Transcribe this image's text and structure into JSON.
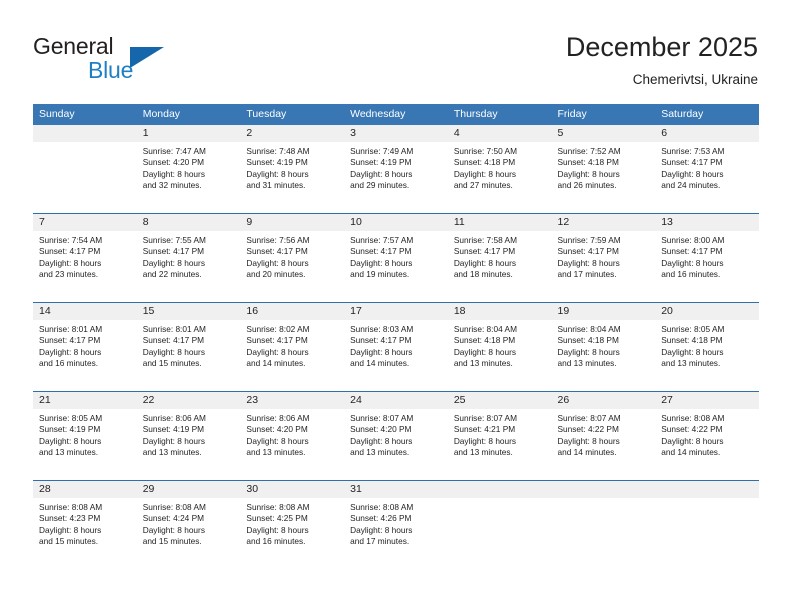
{
  "brand": {
    "name_part1": "General",
    "name_part2": "Blue",
    "logo_icon": "triangle-logo-icon"
  },
  "header": {
    "title": "December 2025",
    "subtitle": "Chemerivtsi, Ukraine"
  },
  "calendar": {
    "day_headers": [
      "Sunday",
      "Monday",
      "Tuesday",
      "Wednesday",
      "Thursday",
      "Friday",
      "Saturday"
    ],
    "colors": {
      "header_blue": "#3877b4",
      "row_divider_blue": "#2f6fad",
      "number_band_gray": "#f0f0f0",
      "brand_blue": "#1f7fc4",
      "logo_blue": "#1566ab"
    },
    "weeks": [
      {
        "days": [
          {
            "number": "",
            "sunrise": "",
            "sunset": "",
            "daylight_line1": "",
            "daylight_line2": ""
          },
          {
            "number": "1",
            "sunrise": "Sunrise: 7:47 AM",
            "sunset": "Sunset: 4:20 PM",
            "daylight_line1": "Daylight: 8 hours",
            "daylight_line2": "and 32 minutes."
          },
          {
            "number": "2",
            "sunrise": "Sunrise: 7:48 AM",
            "sunset": "Sunset: 4:19 PM",
            "daylight_line1": "Daylight: 8 hours",
            "daylight_line2": "and 31 minutes."
          },
          {
            "number": "3",
            "sunrise": "Sunrise: 7:49 AM",
            "sunset": "Sunset: 4:19 PM",
            "daylight_line1": "Daylight: 8 hours",
            "daylight_line2": "and 29 minutes."
          },
          {
            "number": "4",
            "sunrise": "Sunrise: 7:50 AM",
            "sunset": "Sunset: 4:18 PM",
            "daylight_line1": "Daylight: 8 hours",
            "daylight_line2": "and 27 minutes."
          },
          {
            "number": "5",
            "sunrise": "Sunrise: 7:52 AM",
            "sunset": "Sunset: 4:18 PM",
            "daylight_line1": "Daylight: 8 hours",
            "daylight_line2": "and 26 minutes."
          },
          {
            "number": "6",
            "sunrise": "Sunrise: 7:53 AM",
            "sunset": "Sunset: 4:17 PM",
            "daylight_line1": "Daylight: 8 hours",
            "daylight_line2": "and 24 minutes."
          }
        ]
      },
      {
        "days": [
          {
            "number": "7",
            "sunrise": "Sunrise: 7:54 AM",
            "sunset": "Sunset: 4:17 PM",
            "daylight_line1": "Daylight: 8 hours",
            "daylight_line2": "and 23 minutes."
          },
          {
            "number": "8",
            "sunrise": "Sunrise: 7:55 AM",
            "sunset": "Sunset: 4:17 PM",
            "daylight_line1": "Daylight: 8 hours",
            "daylight_line2": "and 22 minutes."
          },
          {
            "number": "9",
            "sunrise": "Sunrise: 7:56 AM",
            "sunset": "Sunset: 4:17 PM",
            "daylight_line1": "Daylight: 8 hours",
            "daylight_line2": "and 20 minutes."
          },
          {
            "number": "10",
            "sunrise": "Sunrise: 7:57 AM",
            "sunset": "Sunset: 4:17 PM",
            "daylight_line1": "Daylight: 8 hours",
            "daylight_line2": "and 19 minutes."
          },
          {
            "number": "11",
            "sunrise": "Sunrise: 7:58 AM",
            "sunset": "Sunset: 4:17 PM",
            "daylight_line1": "Daylight: 8 hours",
            "daylight_line2": "and 18 minutes."
          },
          {
            "number": "12",
            "sunrise": "Sunrise: 7:59 AM",
            "sunset": "Sunset: 4:17 PM",
            "daylight_line1": "Daylight: 8 hours",
            "daylight_line2": "and 17 minutes."
          },
          {
            "number": "13",
            "sunrise": "Sunrise: 8:00 AM",
            "sunset": "Sunset: 4:17 PM",
            "daylight_line1": "Daylight: 8 hours",
            "daylight_line2": "and 16 minutes."
          }
        ]
      },
      {
        "days": [
          {
            "number": "14",
            "sunrise": "Sunrise: 8:01 AM",
            "sunset": "Sunset: 4:17 PM",
            "daylight_line1": "Daylight: 8 hours",
            "daylight_line2": "and 16 minutes."
          },
          {
            "number": "15",
            "sunrise": "Sunrise: 8:01 AM",
            "sunset": "Sunset: 4:17 PM",
            "daylight_line1": "Daylight: 8 hours",
            "daylight_line2": "and 15 minutes."
          },
          {
            "number": "16",
            "sunrise": "Sunrise: 8:02 AM",
            "sunset": "Sunset: 4:17 PM",
            "daylight_line1": "Daylight: 8 hours",
            "daylight_line2": "and 14 minutes."
          },
          {
            "number": "17",
            "sunrise": "Sunrise: 8:03 AM",
            "sunset": "Sunset: 4:17 PM",
            "daylight_line1": "Daylight: 8 hours",
            "daylight_line2": "and 14 minutes."
          },
          {
            "number": "18",
            "sunrise": "Sunrise: 8:04 AM",
            "sunset": "Sunset: 4:18 PM",
            "daylight_line1": "Daylight: 8 hours",
            "daylight_line2": "and 13 minutes."
          },
          {
            "number": "19",
            "sunrise": "Sunrise: 8:04 AM",
            "sunset": "Sunset: 4:18 PM",
            "daylight_line1": "Daylight: 8 hours",
            "daylight_line2": "and 13 minutes."
          },
          {
            "number": "20",
            "sunrise": "Sunrise: 8:05 AM",
            "sunset": "Sunset: 4:18 PM",
            "daylight_line1": "Daylight: 8 hours",
            "daylight_line2": "and 13 minutes."
          }
        ]
      },
      {
        "days": [
          {
            "number": "21",
            "sunrise": "Sunrise: 8:05 AM",
            "sunset": "Sunset: 4:19 PM",
            "daylight_line1": "Daylight: 8 hours",
            "daylight_line2": "and 13 minutes."
          },
          {
            "number": "22",
            "sunrise": "Sunrise: 8:06 AM",
            "sunset": "Sunset: 4:19 PM",
            "daylight_line1": "Daylight: 8 hours",
            "daylight_line2": "and 13 minutes."
          },
          {
            "number": "23",
            "sunrise": "Sunrise: 8:06 AM",
            "sunset": "Sunset: 4:20 PM",
            "daylight_line1": "Daylight: 8 hours",
            "daylight_line2": "and 13 minutes."
          },
          {
            "number": "24",
            "sunrise": "Sunrise: 8:07 AM",
            "sunset": "Sunset: 4:20 PM",
            "daylight_line1": "Daylight: 8 hours",
            "daylight_line2": "and 13 minutes."
          },
          {
            "number": "25",
            "sunrise": "Sunrise: 8:07 AM",
            "sunset": "Sunset: 4:21 PM",
            "daylight_line1": "Daylight: 8 hours",
            "daylight_line2": "and 13 minutes."
          },
          {
            "number": "26",
            "sunrise": "Sunrise: 8:07 AM",
            "sunset": "Sunset: 4:22 PM",
            "daylight_line1": "Daylight: 8 hours",
            "daylight_line2": "and 14 minutes."
          },
          {
            "number": "27",
            "sunrise": "Sunrise: 8:08 AM",
            "sunset": "Sunset: 4:22 PM",
            "daylight_line1": "Daylight: 8 hours",
            "daylight_line2": "and 14 minutes."
          }
        ]
      },
      {
        "days": [
          {
            "number": "28",
            "sunrise": "Sunrise: 8:08 AM",
            "sunset": "Sunset: 4:23 PM",
            "daylight_line1": "Daylight: 8 hours",
            "daylight_line2": "and 15 minutes."
          },
          {
            "number": "29",
            "sunrise": "Sunrise: 8:08 AM",
            "sunset": "Sunset: 4:24 PM",
            "daylight_line1": "Daylight: 8 hours",
            "daylight_line2": "and 15 minutes."
          },
          {
            "number": "30",
            "sunrise": "Sunrise: 8:08 AM",
            "sunset": "Sunset: 4:25 PM",
            "daylight_line1": "Daylight: 8 hours",
            "daylight_line2": "and 16 minutes."
          },
          {
            "number": "31",
            "sunrise": "Sunrise: 8:08 AM",
            "sunset": "Sunset: 4:26 PM",
            "daylight_line1": "Daylight: 8 hours",
            "daylight_line2": "and 17 minutes."
          },
          {
            "number": "",
            "sunrise": "",
            "sunset": "",
            "daylight_line1": "",
            "daylight_line2": ""
          },
          {
            "number": "",
            "sunrise": "",
            "sunset": "",
            "daylight_line1": "",
            "daylight_line2": ""
          },
          {
            "number": "",
            "sunrise": "",
            "sunset": "",
            "daylight_line1": "",
            "daylight_line2": ""
          }
        ]
      }
    ]
  }
}
